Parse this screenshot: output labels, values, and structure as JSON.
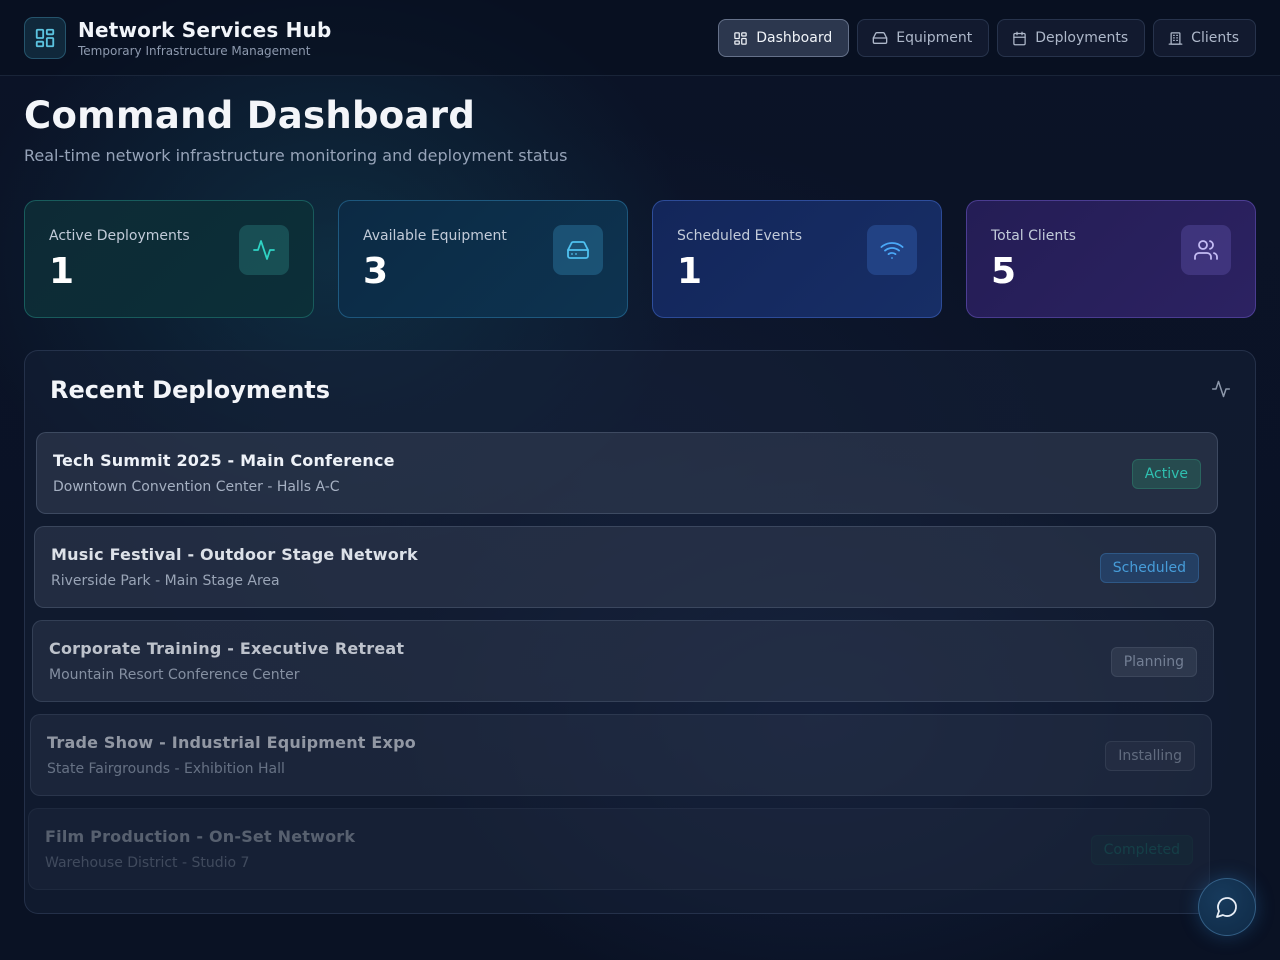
{
  "brand": {
    "title": "Network Services Hub",
    "subtitle": "Temporary Infrastructure Management",
    "icon": "grid-icon"
  },
  "nav": {
    "items": [
      {
        "label": "Dashboard",
        "icon": "grid-icon",
        "active": true
      },
      {
        "label": "Equipment",
        "icon": "hard-drive-icon",
        "active": false
      },
      {
        "label": "Deployments",
        "icon": "calendar-icon",
        "active": false
      },
      {
        "label": "Clients",
        "icon": "building-icon",
        "active": false
      }
    ]
  },
  "page": {
    "title": "Command Dashboard",
    "subtitle": "Real-time network infrastructure monitoring and deployment status"
  },
  "stats": [
    {
      "label": "Active Deployments",
      "value": "1",
      "icon": "activity-icon",
      "color": "#2fd3c4"
    },
    {
      "label": "Available Equipment",
      "value": "3",
      "icon": "hard-drive-icon",
      "color": "#4fc1f0"
    },
    {
      "label": "Scheduled Events",
      "value": "1",
      "icon": "wifi-icon",
      "color": "#4aa8f8"
    },
    {
      "label": "Total Clients",
      "value": "5",
      "icon": "users-icon",
      "color": "#b9b0f0"
    }
  ],
  "recent": {
    "title": "Recent Deployments",
    "icon": "activity-icon",
    "items": [
      {
        "name": "Tech Summit 2025 - Main Conference",
        "location": "Downtown Convention Center - Halls A-C",
        "status": "Active"
      },
      {
        "name": "Music Festival - Outdoor Stage Network",
        "location": "Riverside Park - Main Stage Area",
        "status": "Scheduled"
      },
      {
        "name": "Corporate Training - Executive Retreat",
        "location": "Mountain Resort Conference Center",
        "status": "Planning"
      },
      {
        "name": "Trade Show - Industrial Equipment Expo",
        "location": "State Fairgrounds - Exhibition Hall",
        "status": "Installing"
      },
      {
        "name": "Film Production - On-Set Network",
        "location": "Warehouse District - Studio 7",
        "status": "Completed"
      }
    ]
  },
  "chat": {
    "icon": "message-circle-icon"
  }
}
